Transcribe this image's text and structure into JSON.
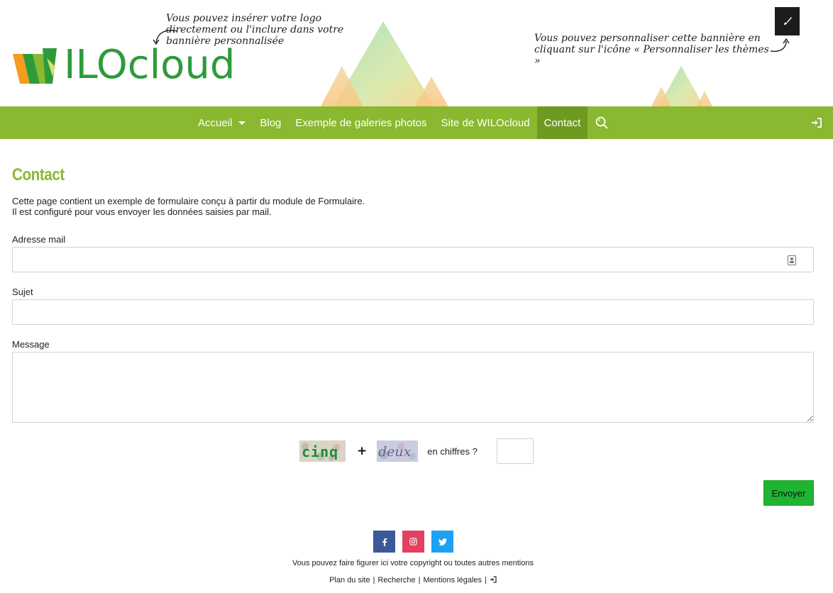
{
  "banner": {
    "logo_text": "ILOcloud",
    "hint_logo": "Vous pouvez insérer votre logo directement ou l'inclure dans votre bannière personnalisée",
    "hint_banner": "Vous pouvez personnaliser cette bannière en cliquant sur l'icône « Personnaliser les thèmes »",
    "customize_icon": "paintbrush-icon"
  },
  "nav": {
    "items": [
      {
        "label": "Accueil",
        "has_dropdown": true
      },
      {
        "label": "Blog"
      },
      {
        "label": "Exemple de galeries photos"
      },
      {
        "label": "Site de WILOcloud"
      },
      {
        "label": "Contact",
        "active": true
      }
    ],
    "search_icon": "search-icon",
    "login_icon": "sign-in-icon",
    "color": "#8ab830",
    "active_color": "#6f9a22"
  },
  "page": {
    "title": "Contact",
    "intro_line1": "Cette page contient un exemple de formulaire conçu à partir du module de Formulaire.",
    "intro_line2": "Il est configuré pour vous envoyer les données saisies par mail."
  },
  "form": {
    "email_label": "Adresse mail",
    "email_value": "",
    "subject_label": "Sujet",
    "subject_value": "",
    "message_label": "Message",
    "message_value": "",
    "captcha_word1": "cinq",
    "captcha_word2": "deux",
    "captcha_operator": "+",
    "captcha_question": "en chiffres ?",
    "captcha_value": "",
    "submit_label": "Envoyer",
    "submit_color": "#20b433"
  },
  "footer": {
    "social": [
      "facebook-icon",
      "instagram-icon",
      "twitter-icon"
    ],
    "copyright": "Vous pouvez faire figurer ici votre copyright ou toutes autres mentions",
    "links": [
      "Plan du site",
      "Recherche",
      "Mentions légales"
    ],
    "separator": "|"
  }
}
